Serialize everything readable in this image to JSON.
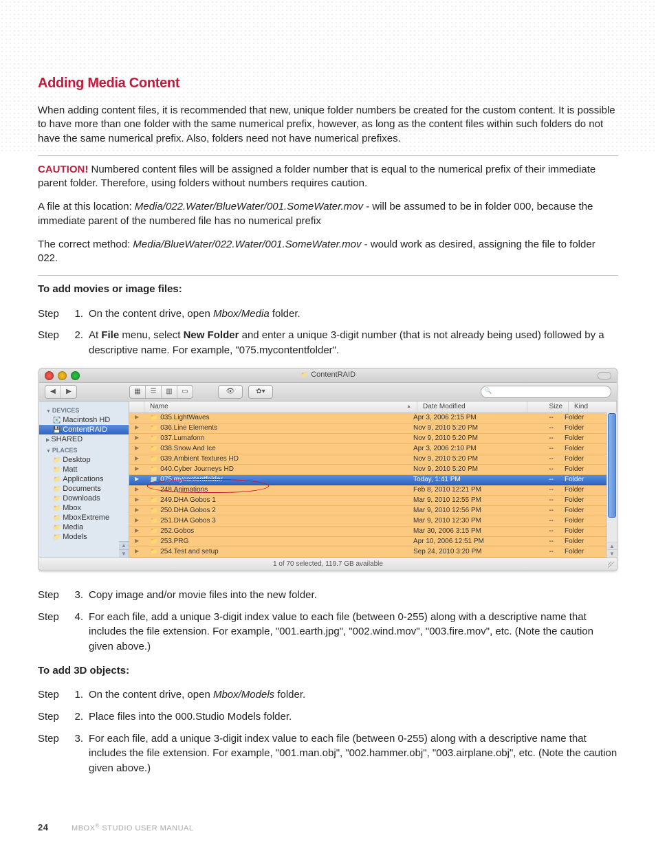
{
  "page": {
    "number": "24",
    "footer_text": "MBOX® STUDIO USER MANUAL"
  },
  "heading": "Adding Media Content",
  "intro": "When adding content files, it is recommended that new, unique folder numbers be created for the custom content. It is possible to have more than one folder with the same numerical prefix, however, as long as the content files within such folders do not have the same numerical prefix. Also, folders need not have numerical prefixes.",
  "caution_label": "CAUTION!",
  "caution_text": "  Numbered content files will be assigned a folder number that is equal to the numerical prefix of their immediate parent folder. Therefore, using folders without numbers requires caution.",
  "para2_a": "A file at this location: ",
  "para2_path": "Media/022.Water/BlueWater/001.SomeWater.mov",
  "para2_b": " - will be assumed to be in folder 000, because the immediate parent of the numbered file has no numerical prefix",
  "para3_a": "The correct method: ",
  "para3_path": "Media/BlueWater/022.Water/001.SomeWater.mov",
  "para3_b": " - would work as desired, assigning the file to folder 022.",
  "subhead1": "To add movies or image files:",
  "labels": {
    "step": "Step"
  },
  "steps_movies": [
    {
      "n": "1.",
      "html": "On the content drive, open <span class='ital'>Mbox/Media</span> folder."
    },
    {
      "n": "2.",
      "html": "At <span class='bold'>File</span> menu, select <span class='bold'>New Folder</span> and enter a unique 3-digit number (that is not already being used) followed by a descriptive name. For example, \"075.mycontentfolder\"."
    },
    {
      "n": "3.",
      "html": "Copy image and/or movie files into the new folder."
    },
    {
      "n": "4.",
      "html": "For each file, add a unique 3-digit index value to each file (between 0-255) along with a descriptive name that includes the file extension. For example, \"001.earth.jpg\", \"002.wind.mov\", \"003.fire.mov\", etc. (Note the caution given above.)"
    }
  ],
  "subhead2": "To add 3D objects:",
  "steps_3d": [
    {
      "n": "1.",
      "html": "On the content drive, open <span class='ital'>Mbox/Models</span> folder."
    },
    {
      "n": "2.",
      "html": "Place files into the 000.Studio Models folder."
    },
    {
      "n": "3.",
      "html": "For each file, add a unique 3-digit index value to each file (between 0-255) along with a descriptive name that includes the file extension. For example, \"001.man.obj\", \"002.hammer.obj\", \"003.airplane.obj\", etc. (Note the caution given above.)"
    }
  ],
  "finder": {
    "title": "ContentRAID",
    "search_placeholder": "",
    "sidebar": {
      "devices_label": "DEVICES",
      "devices": [
        {
          "label": "Macintosh HD",
          "sel": false
        },
        {
          "label": "ContentRAID",
          "sel": true
        }
      ],
      "shared_label": "SHARED",
      "places_label": "PLACES",
      "places": [
        "Desktop",
        "Matt",
        "Applications",
        "Documents",
        "Downloads",
        "Mbox",
        "MboxExtreme",
        "Media",
        "Models"
      ]
    },
    "columns": {
      "name": "Name",
      "date": "Date Modified",
      "size": "Size",
      "kind": "Kind"
    },
    "rows": [
      {
        "name": "035.LightWaves",
        "date": "Apr 3, 2006 2:15 PM",
        "size": "--",
        "kind": "Folder",
        "sel": false
      },
      {
        "name": "036.Line Elements",
        "date": "Nov 9, 2010 5:20 PM",
        "size": "--",
        "kind": "Folder",
        "sel": false
      },
      {
        "name": "037.Lumaform",
        "date": "Nov 9, 2010 5:20 PM",
        "size": "--",
        "kind": "Folder",
        "sel": false
      },
      {
        "name": "038.Snow And Ice",
        "date": "Apr 3, 2006 2:10 PM",
        "size": "--",
        "kind": "Folder",
        "sel": false
      },
      {
        "name": "039.Ambient Textures HD",
        "date": "Nov 9, 2010 5:20 PM",
        "size": "--",
        "kind": "Folder",
        "sel": false
      },
      {
        "name": "040.Cyber Journeys HD",
        "date": "Nov 9, 2010 5:20 PM",
        "size": "--",
        "kind": "Folder",
        "sel": false
      },
      {
        "name": "075.mycontentfolder",
        "date": "Today, 1:41 PM",
        "size": "--",
        "kind": "Folder",
        "sel": true
      },
      {
        "name": "248.Animations",
        "date": "Feb 8, 2010 12:21 PM",
        "size": "--",
        "kind": "Folder",
        "sel": false
      },
      {
        "name": "249.DHA Gobos 1",
        "date": "Mar 9, 2010 12:55 PM",
        "size": "--",
        "kind": "Folder",
        "sel": false
      },
      {
        "name": "250.DHA Gobos 2",
        "date": "Mar 9, 2010 12:56 PM",
        "size": "--",
        "kind": "Folder",
        "sel": false
      },
      {
        "name": "251.DHA Gobos 3",
        "date": "Mar 9, 2010 12:30 PM",
        "size": "--",
        "kind": "Folder",
        "sel": false
      },
      {
        "name": "252.Gobos",
        "date": "Mar 30, 2006 3:15 PM",
        "size": "--",
        "kind": "Folder",
        "sel": false
      },
      {
        "name": "253.PRG",
        "date": "Apr 10, 2006 12:51 PM",
        "size": "--",
        "kind": "Folder",
        "sel": false
      },
      {
        "name": "254.Test and setup",
        "date": "Sep 24, 2010 3:20 PM",
        "size": "--",
        "kind": "Folder",
        "sel": false
      }
    ],
    "status": "1 of 70 selected, 119.7 GB available"
  }
}
